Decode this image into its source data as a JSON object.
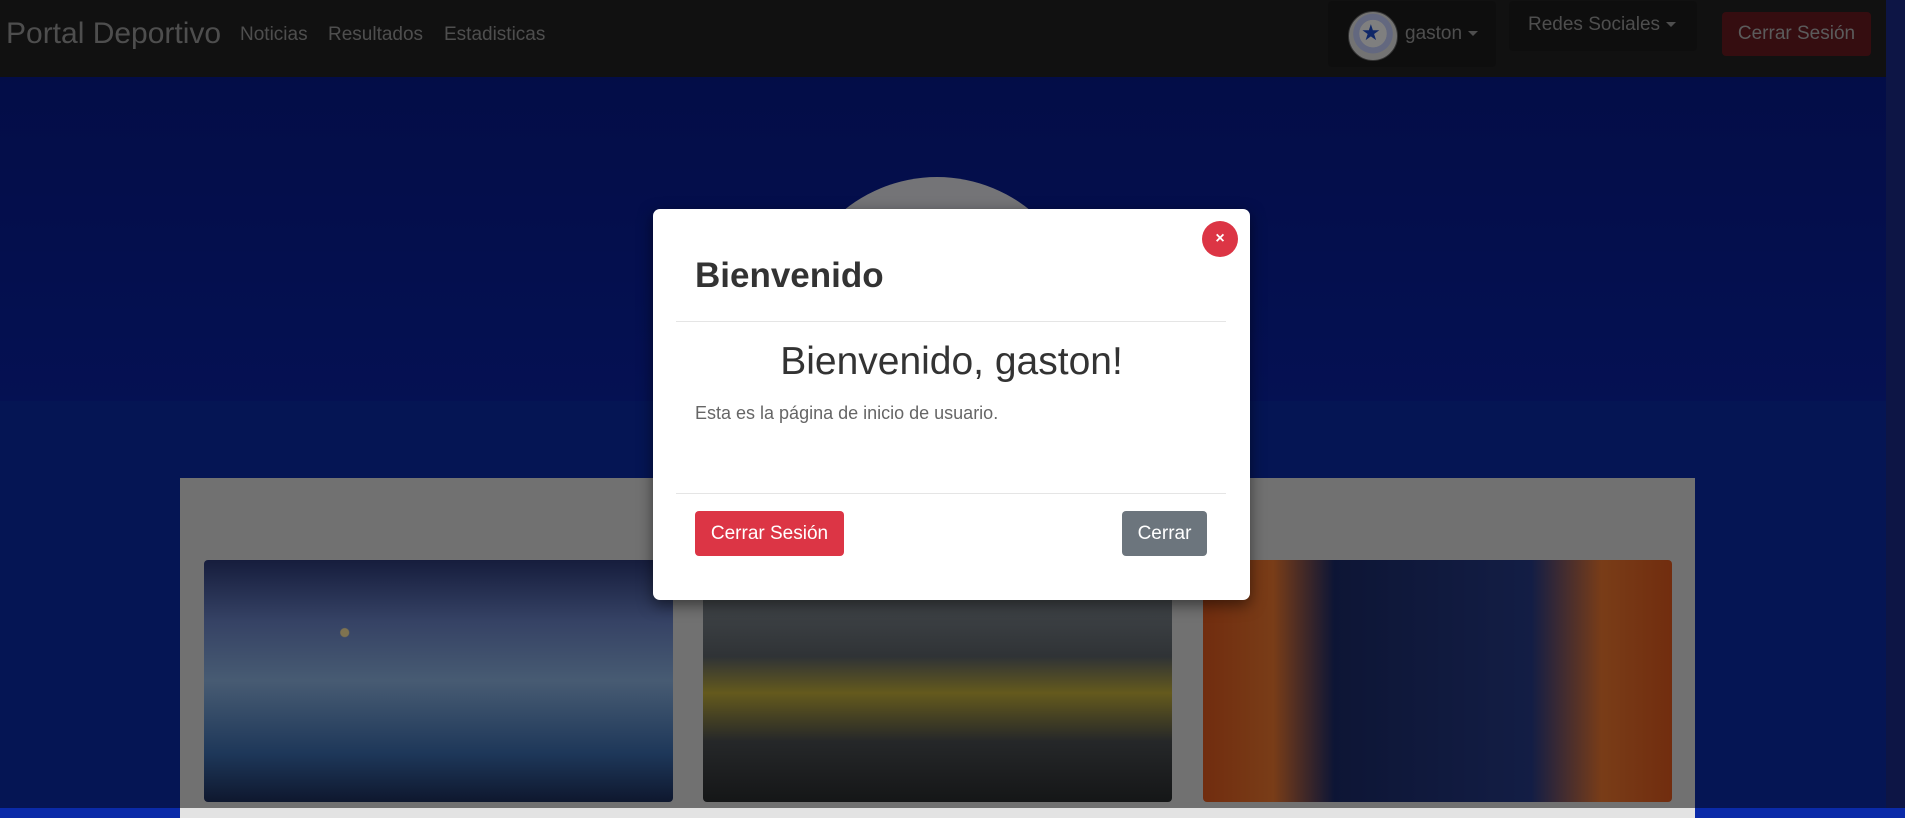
{
  "navbar": {
    "brand": "Portal Deportivo",
    "links": [
      "Noticias",
      "Resultados",
      "Estadisticas"
    ],
    "user": {
      "name": "gaston"
    },
    "social_label": "Redes Sociales",
    "logout_label": "Cerrar Sesión"
  },
  "modal": {
    "title": "Bienvenido",
    "close_symbol": "×",
    "heading": "Bienvenido, gaston!",
    "text": "Esta es la página de inicio de usuario.",
    "logout_label": "Cerrar Sesión",
    "close_label": "Cerrar"
  },
  "colors": {
    "danger": "#dc3545",
    "secondary": "#6c757d",
    "navbar": "#222222",
    "hero": "#0a22a6"
  }
}
